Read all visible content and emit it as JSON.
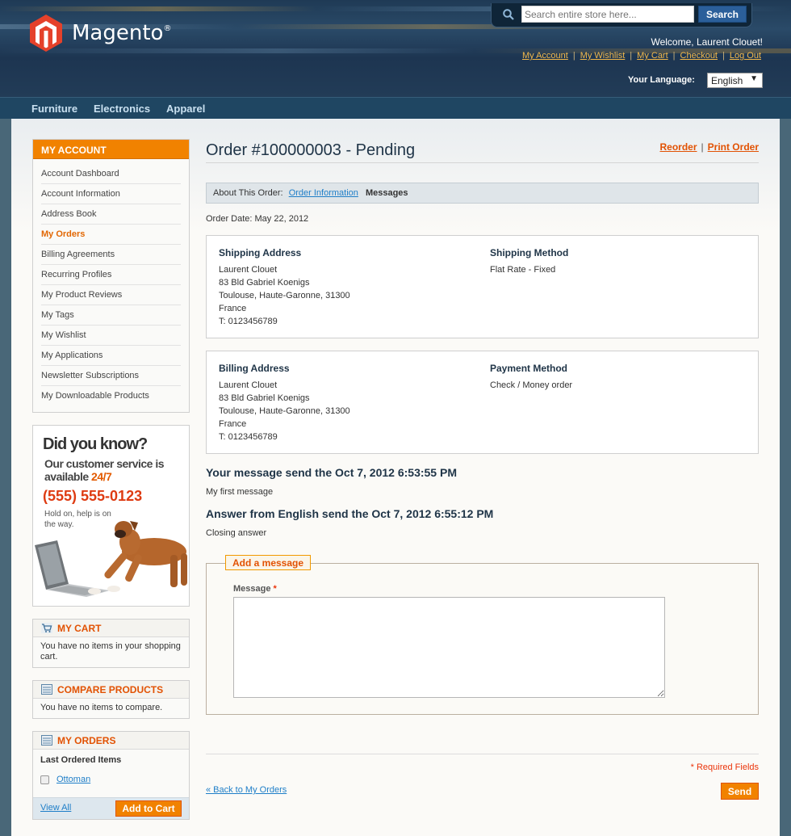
{
  "brand": {
    "name": "Magento",
    "mark": "®"
  },
  "search": {
    "placeholder": "Search entire store here...",
    "button": "Search"
  },
  "header": {
    "welcome": "Welcome, Laurent Clouet!",
    "links": [
      "My Account",
      "My Wishlist",
      "My Cart",
      "Checkout",
      "Log Out"
    ],
    "language_label": "Your Language:",
    "language_value": "English"
  },
  "nav": [
    "Furniture",
    "Electronics",
    "Apparel"
  ],
  "sidebar": {
    "title": "MY ACCOUNT",
    "items": [
      {
        "label": "Account Dashboard"
      },
      {
        "label": "Account Information"
      },
      {
        "label": "Address Book"
      },
      {
        "label": "My Orders"
      },
      {
        "label": "Billing Agreements"
      },
      {
        "label": "Recurring Profiles"
      },
      {
        "label": "My Product Reviews"
      },
      {
        "label": "My Tags"
      },
      {
        "label": "My Wishlist"
      },
      {
        "label": "My Applications"
      },
      {
        "label": "Newsletter Subscriptions"
      },
      {
        "label": "My Downloadable Products"
      }
    ],
    "promo": {
      "title": "Did you know?",
      "line1": "Our customer service is available ",
      "highlight": "24/7",
      "phone": "(555) 555-0123",
      "note": "Hold on, help is on the way."
    },
    "cart": {
      "title": "MY CART",
      "text": "You have no items in your shopping cart."
    },
    "compare": {
      "title": "COMPARE PRODUCTS",
      "text": "You have no items to compare."
    },
    "orders": {
      "title": "MY ORDERS",
      "subtitle": "Last Ordered Items",
      "item": "Ottoman",
      "view_all": "View All",
      "add_to_cart": "Add to Cart"
    }
  },
  "order": {
    "title": "Order #100000003 - Pending",
    "reorder": "Reorder",
    "print": "Print Order",
    "about_label": "About This Order:",
    "tab_info": "Order Information",
    "tab_messages": "Messages",
    "date": "Order Date: May 22, 2012",
    "shipping": {
      "title": "Shipping Address",
      "lines": [
        "Laurent Clouet",
        "83 Bld Gabriel Koenigs",
        "Toulouse, Haute-Garonne, 31300",
        "France",
        "T: 0123456789"
      ]
    },
    "shipping_method": {
      "title": "Shipping Method",
      "value": "Flat Rate - Fixed"
    },
    "billing": {
      "title": "Billing Address",
      "lines": [
        "Laurent Clouet",
        "83 Bld Gabriel Koenigs",
        "Toulouse, Haute-Garonne, 31300",
        "France",
        "T: 0123456789"
      ]
    },
    "payment_method": {
      "title": "Payment Method",
      "value": "Check / Money order"
    }
  },
  "messages": [
    {
      "heading": "Your message send the Oct 7, 2012 6:53:55 PM",
      "body": "My first message"
    },
    {
      "heading": "Answer from English send the Oct 7, 2012 6:55:12 PM",
      "body": "Closing answer"
    }
  ],
  "form": {
    "legend": "Add a message",
    "label": "Message",
    "required_mark": "*",
    "required_note": "* Required Fields",
    "back": "« Back to My Orders",
    "send": "Send"
  },
  "colors": {
    "accent": "#f18200",
    "link": "#1e7ec8",
    "header": "#1f3a55"
  }
}
